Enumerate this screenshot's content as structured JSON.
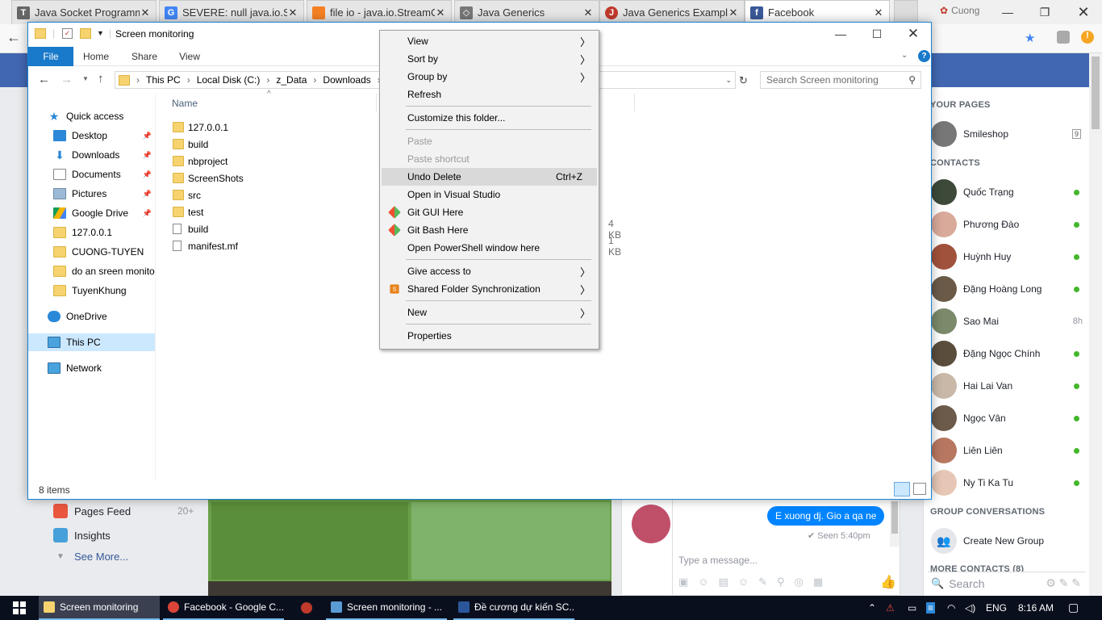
{
  "chrome": {
    "tabs": [
      {
        "title": "Java Socket Programmi",
        "icon": "text-T-icon",
        "active": false
      },
      {
        "title": "SEVERE: null java.io.Stre",
        "icon": "google-icon",
        "active": false
      },
      {
        "title": "file io - java.io.StreamC",
        "icon": "stackoverflow-icon",
        "active": false
      },
      {
        "title": "Java Generics",
        "icon": "diamond-icon",
        "active": false
      },
      {
        "title": "Java Generics Example",
        "icon": "javacodegeeks-icon",
        "active": false
      },
      {
        "title": "Facebook",
        "icon": "facebook-icon",
        "active": true
      }
    ],
    "close_glyph": "✕",
    "profile_name": "Cuong"
  },
  "explorer": {
    "title": "Screen monitoring",
    "ribbon_tabs": [
      "File",
      "Home",
      "Share",
      "View"
    ],
    "breadcrumb": [
      "This PC",
      "Local Disk (C:)",
      "z_Data",
      "Downloads"
    ],
    "search_placeholder": "Search Screen monitoring",
    "nav": [
      {
        "label": "Quick access",
        "icon": "star-icon",
        "pinned": false,
        "indent": 0
      },
      {
        "label": "Desktop",
        "icon": "desktop-icon",
        "pinned": true,
        "indent": 1
      },
      {
        "label": "Downloads",
        "icon": "download-icon",
        "pinned": true,
        "indent": 1
      },
      {
        "label": "Documents",
        "icon": "documents-icon",
        "pinned": true,
        "indent": 1
      },
      {
        "label": "Pictures",
        "icon": "pictures-icon",
        "pinned": true,
        "indent": 1
      },
      {
        "label": "Google Drive",
        "icon": "google-drive-icon",
        "pinned": true,
        "indent": 1
      },
      {
        "label": "127.0.0.1",
        "icon": "folder-icon",
        "pinned": false,
        "indent": 1
      },
      {
        "label": "CUONG-TUYEN",
        "icon": "folder-icon",
        "pinned": false,
        "indent": 1
      },
      {
        "label": "do an sreen monito",
        "icon": "folder-icon",
        "pinned": false,
        "indent": 1
      },
      {
        "label": "TuyenKhung",
        "icon": "folder-icon",
        "pinned": false,
        "indent": 1
      },
      {
        "label": "OneDrive",
        "icon": "onedrive-icon",
        "pinned": false,
        "indent": 0
      },
      {
        "label": "This PC",
        "icon": "this-pc-icon",
        "pinned": false,
        "indent": 0,
        "selected": true
      },
      {
        "label": "Network",
        "icon": "network-icon",
        "pinned": false,
        "indent": 0
      }
    ],
    "column_name": "Name",
    "files": [
      {
        "name": "127.0.0.1",
        "type": "folder",
        "size": ""
      },
      {
        "name": "build",
        "type": "folder",
        "size": ""
      },
      {
        "name": "nbproject",
        "type": "folder",
        "size": ""
      },
      {
        "name": "ScreenShots",
        "type": "folder",
        "size": ""
      },
      {
        "name": "src",
        "type": "folder",
        "size": ""
      },
      {
        "name": "test",
        "type": "folder",
        "size": ""
      },
      {
        "name": "build",
        "type": "file",
        "size": "4 KB"
      },
      {
        "name": "manifest.mf",
        "type": "file",
        "size": "1 KB"
      }
    ],
    "status": "8 items"
  },
  "context_menu": {
    "items": [
      {
        "label": "View",
        "submenu": true
      },
      {
        "label": "Sort by",
        "submenu": true
      },
      {
        "label": "Group by",
        "submenu": true
      },
      {
        "label": "Refresh"
      },
      {
        "sep": true
      },
      {
        "label": "Customize this folder..."
      },
      {
        "sep": true
      },
      {
        "label": "Paste",
        "disabled": true
      },
      {
        "label": "Paste shortcut",
        "disabled": true
      },
      {
        "label": "Undo Delete",
        "accel": "Ctrl+Z",
        "highlighted": true
      },
      {
        "label": "Open in Visual Studio"
      },
      {
        "label": "Git GUI Here",
        "icon": "git-icon"
      },
      {
        "label": "Git Bash Here",
        "icon": "git-icon"
      },
      {
        "label": "Open PowerShell window here"
      },
      {
        "sep": true
      },
      {
        "label": "Give access to",
        "submenu": true
      },
      {
        "label": "Shared Folder Synchronization",
        "submenu": true,
        "icon": "sync-icon"
      },
      {
        "sep": true
      },
      {
        "label": "New",
        "submenu": true
      },
      {
        "sep": true
      },
      {
        "label": "Properties"
      }
    ]
  },
  "facebook": {
    "your_pages_header": "YOUR PAGES",
    "page": {
      "name": "Smileshop",
      "badge": "9"
    },
    "contacts_header": "CONTACTS",
    "contacts": [
      {
        "name": "Quốc Trạng",
        "status": "online"
      },
      {
        "name": "Phương Đào",
        "status": "online"
      },
      {
        "name": "Huỳnh Huy",
        "status": "online"
      },
      {
        "name": "Đặng Hoàng Long",
        "status": "online"
      },
      {
        "name": "Sao Mai",
        "status": "8h"
      },
      {
        "name": "Đặng Ngọc Chính",
        "status": "online"
      },
      {
        "name": "Hai Lai Van",
        "status": "online"
      },
      {
        "name": "Ngọc Vân",
        "status": "online"
      },
      {
        "name": "Liên Liên",
        "status": "online"
      },
      {
        "name": "Ny Ti Ka Tu",
        "status": "online"
      }
    ],
    "group_header": "GROUP CONVERSATIONS",
    "create_group": "Create New Group",
    "more_contacts": "MORE CONTACTS (8)",
    "search_placeholder": "Search",
    "left_menu": [
      {
        "label": "Pages Feed",
        "count": "20+"
      },
      {
        "label": "Insights",
        "count": ""
      },
      {
        "label": "See More...",
        "count": ""
      }
    ],
    "chat": {
      "message": "E xuong dj. Gio a qa ne",
      "seen": "✔ Seen 5:40pm",
      "input_placeholder": "Type a message..."
    }
  },
  "taskbar": {
    "items": [
      {
        "label": "Screen monitoring",
        "icon": "folder-icon",
        "active": true
      },
      {
        "label": "Facebook - Google C...",
        "icon": "chrome-icon",
        "active": false
      },
      {
        "label": "",
        "icon": "app-icon",
        "active": false
      },
      {
        "label": "Screen monitoring - ...",
        "icon": "netbeans-icon",
        "active": false
      },
      {
        "label": "Đề cương dự kiến SC...",
        "icon": "word-icon",
        "active": false
      }
    ],
    "language": "ENG",
    "time": "8:16 AM"
  }
}
